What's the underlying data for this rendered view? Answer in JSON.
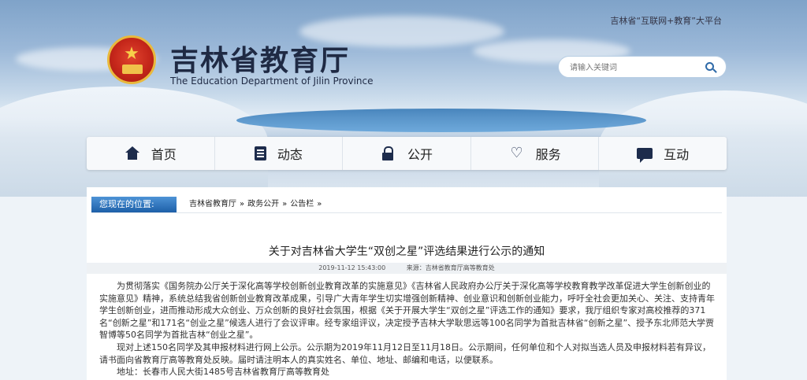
{
  "header": {
    "top_link": "吉林省“互联网+教育”大平台",
    "site_title_cn": "吉林省教育厅",
    "site_title_en": "The Education Department of Jilin Province",
    "search_placeholder": "请输入关键词"
  },
  "nav": [
    {
      "label": "首页",
      "icon": "home-icon"
    },
    {
      "label": "动态",
      "icon": "document-icon"
    },
    {
      "label": "公开",
      "icon": "lock-icon"
    },
    {
      "label": "服务",
      "icon": "heart-hands-icon"
    },
    {
      "label": "互动",
      "icon": "chat-icon"
    }
  ],
  "breadcrumb": {
    "label": "您现在的位置:",
    "items": [
      "吉林省教育厅",
      "政务公开",
      "公告栏"
    ],
    "separator": "»"
  },
  "article": {
    "title": "关于对吉林省大学生“双创之星”评选结果进行公示的通知",
    "date": "2019-11-12 15:43:00",
    "source": "来源：吉林省教育厅高等教育处",
    "paragraphs": [
      "为贯彻落实《国务院办公厅关于深化高等学校创新创业教育改革的实施意见》《吉林省人民政府办公厅关于深化高等学校教育教学改革促进大学生创新创业的实施意见》精神，系统总结我省创新创业教育改革成果，引导广大青年学生切实增强创新精神、创业意识和创新创业能力，呼吁全社会更加关心、关注、支持青年学生创新创业，进而推动形成大众创业、万众创新的良好社会氛围，根据《关于开展大学生“双创之星”评选工作的通知》要求，我厅组织专家对高校推荐的371名“创新之星”和171名“创业之星”候选人进行了会议评审。经专家组评议，决定授予吉林大学耿思远等100名同学为首批吉林省“创新之星”、授予东北师范大学贾智博等50名同学为首批吉林“创业之星”。",
      "现对上述150名同学及其申报材料进行网上公示。公示期为2019年11月12日至11月18日。公示期间，任何单位和个人对拟当选人员及申报材料若有异议，请书面向省教育厅高等教育处反映。届时请注明本人的真实姓名、单位、地址、邮编和电话，以便联系。",
      "地址：长春市人民大街1485号吉林省教育厅高等教育处"
    ]
  },
  "colors": {
    "nav_bg": "#f7f9fb",
    "breadcrumb_accent": "#1d5fa8",
    "title_text": "#1f2a44"
  }
}
